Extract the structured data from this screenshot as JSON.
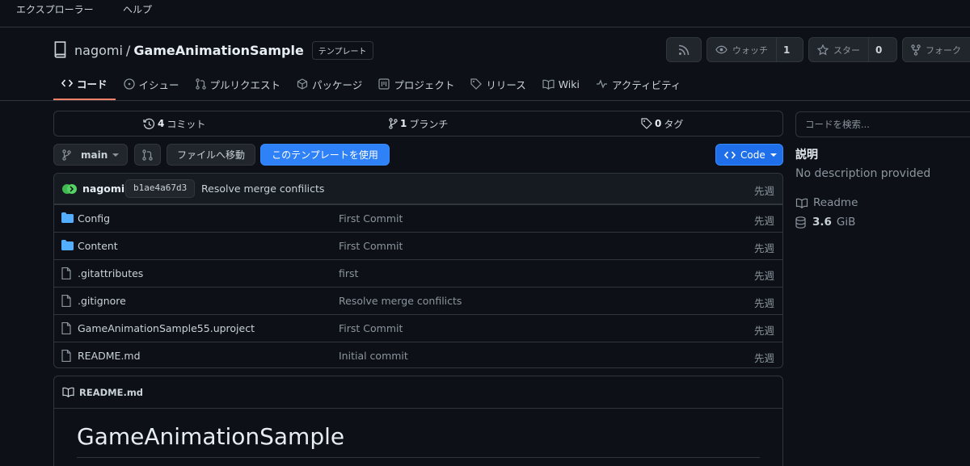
{
  "menubar": {
    "items": [
      "エクスプローラー",
      "ヘルプ"
    ]
  },
  "repo": {
    "owner": "nagomi",
    "separator": "/",
    "name": "GameAnimationSample",
    "badge": "テンプレート"
  },
  "header_buttons": {
    "watch_label": "ウォッチ",
    "watch_count": "1",
    "star_label": "スター",
    "star_count": "0",
    "fork_label": "フォーク"
  },
  "tabs": [
    {
      "label": "コード",
      "icon": "code-icon",
      "active": true
    },
    {
      "label": "イシュー",
      "icon": "issue-icon"
    },
    {
      "label": "プルリクエスト",
      "icon": "pull-request-icon"
    },
    {
      "label": "パッケージ",
      "icon": "package-icon"
    },
    {
      "label": "プロジェクト",
      "icon": "project-icon"
    },
    {
      "label": "リリース",
      "icon": "tag-icon"
    },
    {
      "label": "Wiki",
      "icon": "book-icon"
    },
    {
      "label": "アクティビティ",
      "icon": "pulse-icon"
    }
  ],
  "stats": {
    "commits_count": "4",
    "commits_label": "コミット",
    "branches_count": "1",
    "branches_label": "ブランチ",
    "tags_count": "0",
    "tags_label": "タグ"
  },
  "toolbar": {
    "branch": "main",
    "goto_file": "ファイルへ移動",
    "use_template": "このテンプレートを使用",
    "code": "Code"
  },
  "latest_commit": {
    "author": "nagomi",
    "sha": "b1ae4a67d3",
    "message": "Resolve merge confilicts",
    "time": "先週"
  },
  "files": [
    {
      "name": "Config",
      "type": "folder",
      "message": "First Commit",
      "time": "先週"
    },
    {
      "name": "Content",
      "type": "folder",
      "message": "First Commit",
      "time": "先週"
    },
    {
      "name": ".gitattributes",
      "type": "file",
      "message": "first",
      "time": "先週"
    },
    {
      "name": ".gitignore",
      "type": "file",
      "message": "Resolve merge confilicts",
      "time": "先週"
    },
    {
      "name": "GameAnimationSample55.uproject",
      "type": "file",
      "message": "First Commit",
      "time": "先週"
    },
    {
      "name": "README.md",
      "type": "file",
      "message": "Initial commit",
      "time": "先週"
    }
  ],
  "readme": {
    "filename": "README.md",
    "title": "GameAnimationSample"
  },
  "sidebar": {
    "search_placeholder": "コードを検索...",
    "about_heading": "説明",
    "description": "No description provided",
    "readme_link": "Readme",
    "size_value": "3.6",
    "size_unit": "GiB"
  },
  "colors": {
    "background": "#0d1117",
    "border": "#30363d",
    "accent": "#f78166",
    "primary_button": "#2f81f7",
    "folder": "#54aeff"
  }
}
